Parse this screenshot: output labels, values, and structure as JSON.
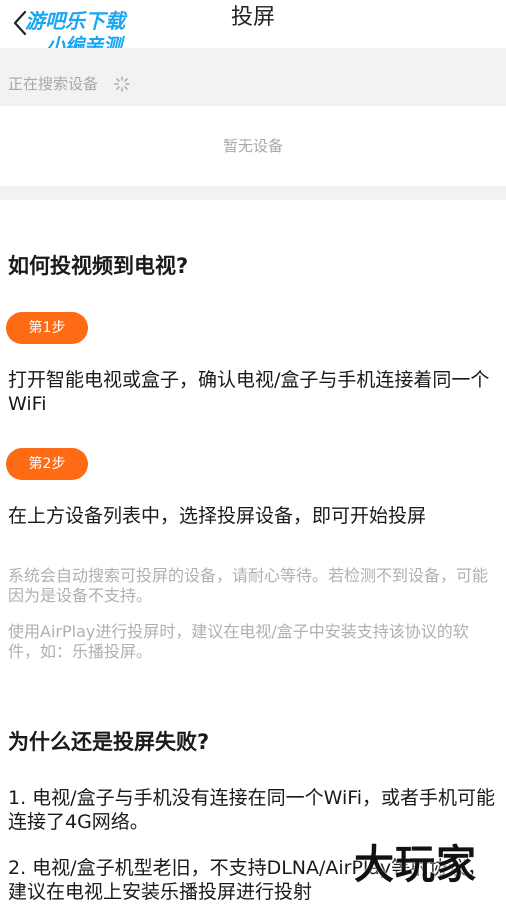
{
  "header": {
    "title": "投屏",
    "back_icon": "chevron-left-icon"
  },
  "watermark": {
    "line1": "游吧乐下载",
    "line2": "小编亲测",
    "color": "#1aa6f0"
  },
  "device_search": {
    "status": "正在搜索设备",
    "spinner_icon": "spinner-icon",
    "empty_text": "暂无设备"
  },
  "guide": {
    "title": "如何投视频到电视?",
    "steps": [
      {
        "badge": "第1步",
        "text": "打开智能电视或盒子，确认电视/盒子与手机连接着同一个WiFi"
      },
      {
        "badge": "第2步",
        "text": "在上方设备列表中，选择投屏设备，即可开始投屏"
      }
    ],
    "notes": [
      "系统会自动搜索可投屏的设备，请耐心等待。若检测不到设备，可能因为是设备不支持。",
      "使用AirPlay进行投屏时，建议在电视/盒子中安装支持该协议的软件，如：乐播投屏。"
    ]
  },
  "faq": {
    "title": "为什么还是投屏失败?",
    "items": [
      "1. 电视/盒子与手机没有连接在同一个WiFi，或者手机可能连接了4G网络。",
      "2. 电视/盒子机型老旧，不支持DLNA/AirPlay等射协议，建议在电视上安装乐播投屏进行投射"
    ]
  },
  "corner_logo": "大玩家",
  "colors": {
    "accent": "#ff6a14",
    "panel_bg": "#f2f2f4",
    "muted_text": "#a8a8a8"
  }
}
